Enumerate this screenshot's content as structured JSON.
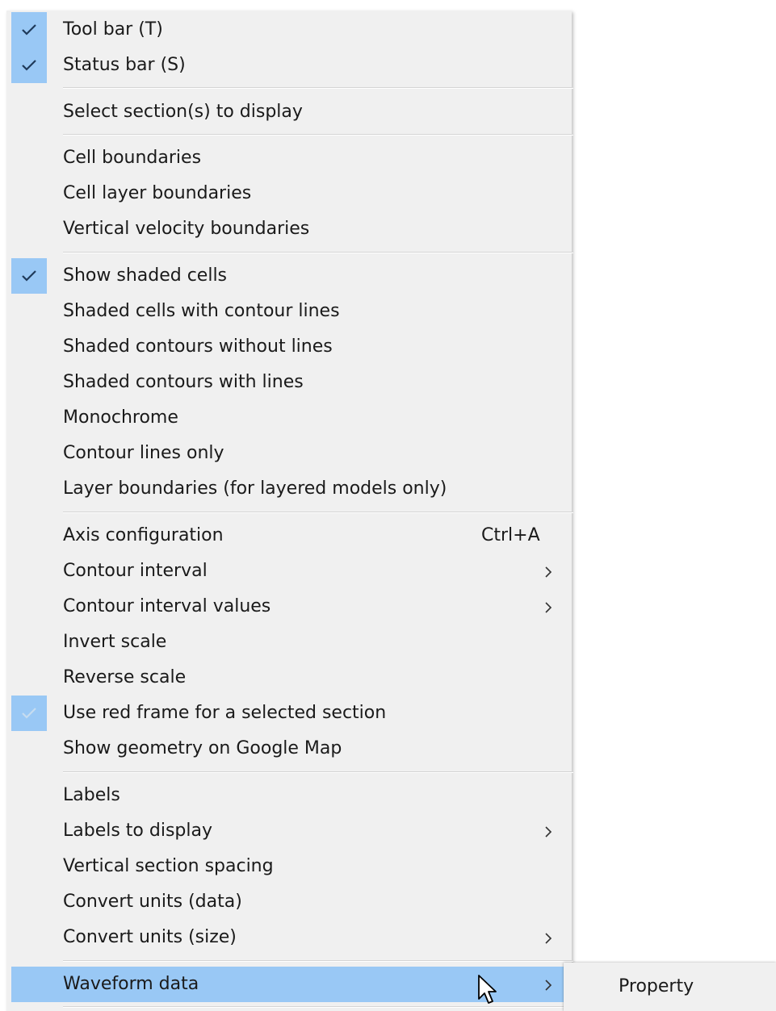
{
  "menu": {
    "items": [
      {
        "label": "Tool bar (T)",
        "checked": true
      },
      {
        "label": "Status bar (S)",
        "checked": true
      },
      {
        "label": "Select section(s) to display"
      },
      {
        "label": "Cell boundaries"
      },
      {
        "label": "Cell layer boundaries"
      },
      {
        "label": "Vertical velocity boundaries"
      },
      {
        "label": "Show shaded cells",
        "checked": true
      },
      {
        "label": "Shaded cells with contour lines"
      },
      {
        "label": "Shaded contours without lines"
      },
      {
        "label": "Shaded contours with lines"
      },
      {
        "label": "Monochrome"
      },
      {
        "label": "Contour lines only"
      },
      {
        "label": "Layer boundaries (for layered models only)"
      },
      {
        "label": "Axis configuration",
        "shortcut": "Ctrl+A"
      },
      {
        "label": "Contour interval",
        "submenu": true
      },
      {
        "label": "Contour interval values",
        "submenu": true
      },
      {
        "label": "Invert scale"
      },
      {
        "label": "Reverse scale"
      },
      {
        "label": "Use red frame for a selected section",
        "checked": true,
        "disabled": true
      },
      {
        "label": "Show geometry on Google Map"
      },
      {
        "label": "Labels"
      },
      {
        "label": "Labels to display",
        "submenu": true
      },
      {
        "label": "Vertical section spacing"
      },
      {
        "label": "Convert units (data)"
      },
      {
        "label": "Convert units (size)",
        "submenu": true
      },
      {
        "label": "Waveform data",
        "submenu": true,
        "highlighted": true
      }
    ]
  },
  "submenu": {
    "items": [
      {
        "label": "Property"
      }
    ]
  },
  "colors": {
    "menu_bg": "#f0f0f0",
    "highlight": "#99c8f5",
    "separator": "#d4d4d4",
    "text": "#1a1a1a"
  },
  "icons": [
    "checkmark-icon",
    "chevron-right-icon",
    "mouse-pointer-icon"
  ]
}
